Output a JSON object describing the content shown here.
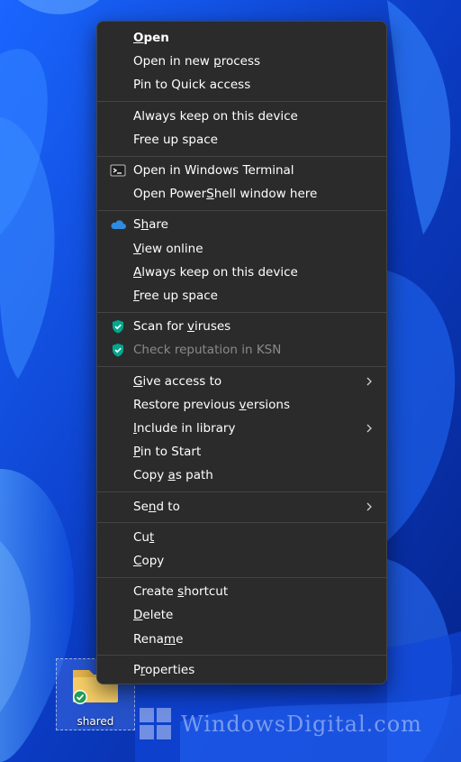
{
  "desktop": {
    "folder_label": "shared",
    "watermark": "WindowsDigital.com"
  },
  "menu": {
    "groups": [
      [
        {
          "pre": "",
          "key": "O",
          "post": "pen",
          "bold": true
        },
        {
          "pre": "Open in new ",
          "key": "p",
          "post": "rocess"
        },
        {
          "pre": "Pin to Quick access",
          "key": "",
          "post": ""
        }
      ],
      [
        {
          "pre": "Always keep on this device",
          "key": "",
          "post": ""
        },
        {
          "pre": "Free up space",
          "key": "",
          "post": ""
        }
      ],
      [
        {
          "pre": "Open in Windows Terminal",
          "key": "",
          "post": "",
          "icon": "terminal-icon"
        },
        {
          "pre": "Open Power",
          "key": "S",
          "post": "hell window here"
        }
      ],
      [
        {
          "pre": "S",
          "key": "h",
          "post": "are",
          "icon": "onedrive-cloud-icon"
        },
        {
          "pre": "",
          "key": "V",
          "post": "iew online"
        },
        {
          "pre": "",
          "key": "A",
          "post": "lways keep on this device"
        },
        {
          "pre": "",
          "key": "F",
          "post": "ree up space"
        }
      ],
      [
        {
          "pre": "Scan for ",
          "key": "v",
          "post": "iruses",
          "icon": "kaspersky-shield-icon"
        },
        {
          "pre": "Check reputation in KSN",
          "key": "",
          "post": "",
          "icon": "kaspersky-shield-icon",
          "disabled": true
        }
      ],
      [
        {
          "pre": "",
          "key": "G",
          "post": "ive access to",
          "submenu": true
        },
        {
          "pre": "Restore previous ",
          "key": "v",
          "post": "ersions"
        },
        {
          "pre": "",
          "key": "I",
          "post": "nclude in library",
          "submenu": true
        },
        {
          "pre": "",
          "key": "P",
          "post": "in to Start"
        },
        {
          "pre": "Copy ",
          "key": "a",
          "post": "s path"
        }
      ],
      [
        {
          "pre": "Se",
          "key": "n",
          "post": "d to",
          "submenu": true
        }
      ],
      [
        {
          "pre": "Cu",
          "key": "t",
          "post": ""
        },
        {
          "pre": "",
          "key": "C",
          "post": "opy"
        }
      ],
      [
        {
          "pre": "Create ",
          "key": "s",
          "post": "hortcut"
        },
        {
          "pre": "",
          "key": "D",
          "post": "elete"
        },
        {
          "pre": "Rena",
          "key": "m",
          "post": "e"
        }
      ],
      [
        {
          "pre": "P",
          "key": "r",
          "post": "operties"
        }
      ]
    ]
  },
  "colors": {
    "menu_bg": "#2b2b2b",
    "separator": "#444444",
    "onedrive": "#2e8be0",
    "kaspersky": "#00a88e",
    "wallpaper": "#0a3fc2"
  }
}
